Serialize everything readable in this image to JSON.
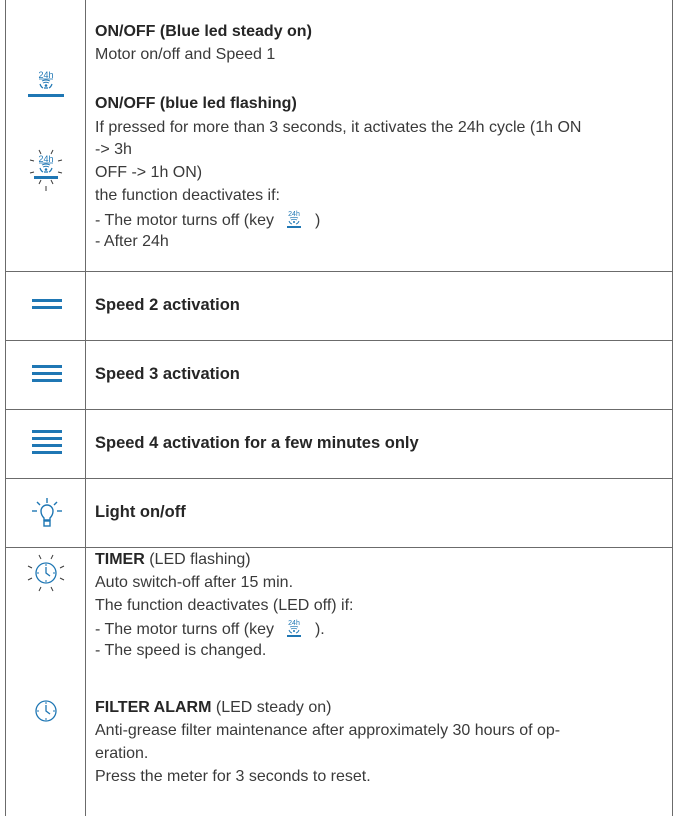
{
  "rows": {
    "onoff": {
      "steady_title": "ON/OFF (Blue led steady on)",
      "steady_text": "Motor on/off and Speed 1",
      "flash_title": "ON/OFF (blue led flashing)",
      "flash_line1": "If pressed for more than 3 seconds, it activates the 24h cycle (1h ON",
      "flash_line2": "-> 3h",
      "flash_line3": "OFF -> 1h ON)",
      "flash_line4": "the function deactivates if:",
      "flash_line5a": "- The motor turns off (key",
      "flash_line5b": ")",
      "flash_line6": "- After 24h",
      "icon_label": "24h"
    },
    "speed2": {
      "label": "Speed 2 activation"
    },
    "speed3": {
      "label": "Speed 3 activation"
    },
    "speed4": {
      "label": "Speed 4 activation for a few minutes only"
    },
    "light": {
      "label": "Light on/off"
    },
    "timer": {
      "title": "TIMER",
      "title_suffix": " (LED flashing)",
      "line1": "Auto switch-off after 15 min.",
      "line2": "The function deactivates (LED off) if:",
      "line3a": "- The motor turns off (key",
      "line3b": ").",
      "line4": "- The speed is changed.",
      "alarm_title": "FILTER ALARM",
      "alarm_suffix": " (LED steady on)",
      "alarm_line1": "Anti-grease filter maintenance after approximately 30 hours of op-",
      "alarm_line2": "eration.",
      "alarm_line3": "Press the meter for 3 seconds to reset."
    }
  },
  "colors": {
    "accent": "#1f77b4",
    "border": "#6b6b6b",
    "text": "#3a3a3a"
  },
  "icons": [
    "fan-24h-icon",
    "fan-24h-flashing-icon",
    "speed-2-icon",
    "speed-3-icon",
    "speed-4-icon",
    "light-bulb-icon",
    "timer-flashing-icon",
    "timer-icon"
  ]
}
